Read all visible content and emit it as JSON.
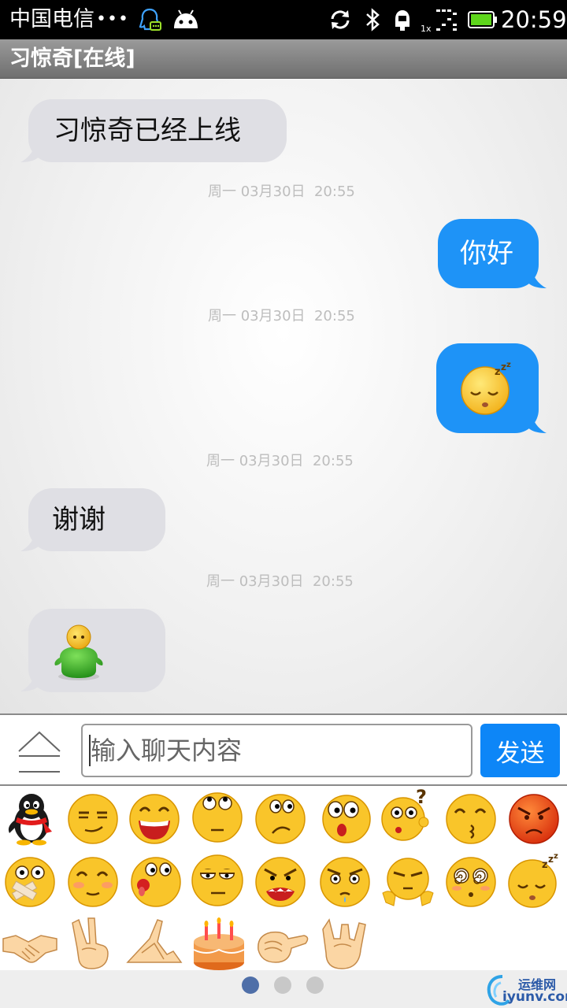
{
  "status_bar": {
    "carrier": "中国电信",
    "dots": "•••",
    "time": "20:59",
    "signal_label": "1x"
  },
  "header": {
    "title": "习惊奇[在线]"
  },
  "messages": [
    {
      "side": "in",
      "type": "text",
      "text": "习惊奇已经上线"
    },
    {
      "timestamp": "周一 03月30日  20:55"
    },
    {
      "side": "out",
      "type": "text",
      "text": "你好"
    },
    {
      "timestamp": "周一 03月30日  20:55"
    },
    {
      "side": "out",
      "type": "emoji",
      "emoji": "sleepy-face"
    },
    {
      "timestamp": "周一 03月30日  20:55"
    },
    {
      "side": "in",
      "type": "text",
      "text": "谢谢"
    },
    {
      "timestamp": "周一 03月30日  20:55"
    },
    {
      "side": "in",
      "type": "emoji",
      "emoji": "green-figure"
    }
  ],
  "input_bar": {
    "placeholder": "输入聊天内容",
    "send_label": "发送"
  },
  "emoji_panel": {
    "rows": [
      [
        "qq-penguin",
        "smirk",
        "laugh",
        "look-up",
        "frown",
        "surprised",
        "confused",
        "shy",
        "angry"
      ],
      [
        "taped-mouth",
        "blush",
        "tongue",
        "bored",
        "rage",
        "teary-angry",
        "shrug",
        "dizzy",
        "sleepy"
      ],
      [
        "handshake",
        "victory",
        "clasp-hands",
        "birthday-cake",
        "fist-bump",
        "rock-on"
      ]
    ],
    "pages": 3,
    "active_page": 1
  },
  "watermark": {
    "line1": "运维网",
    "line2": "iyunv.com"
  },
  "colors": {
    "outgoing_bubble": "#1e93f7",
    "incoming_bubble": "#dfdfe4",
    "send_button": "#0d86f7"
  }
}
